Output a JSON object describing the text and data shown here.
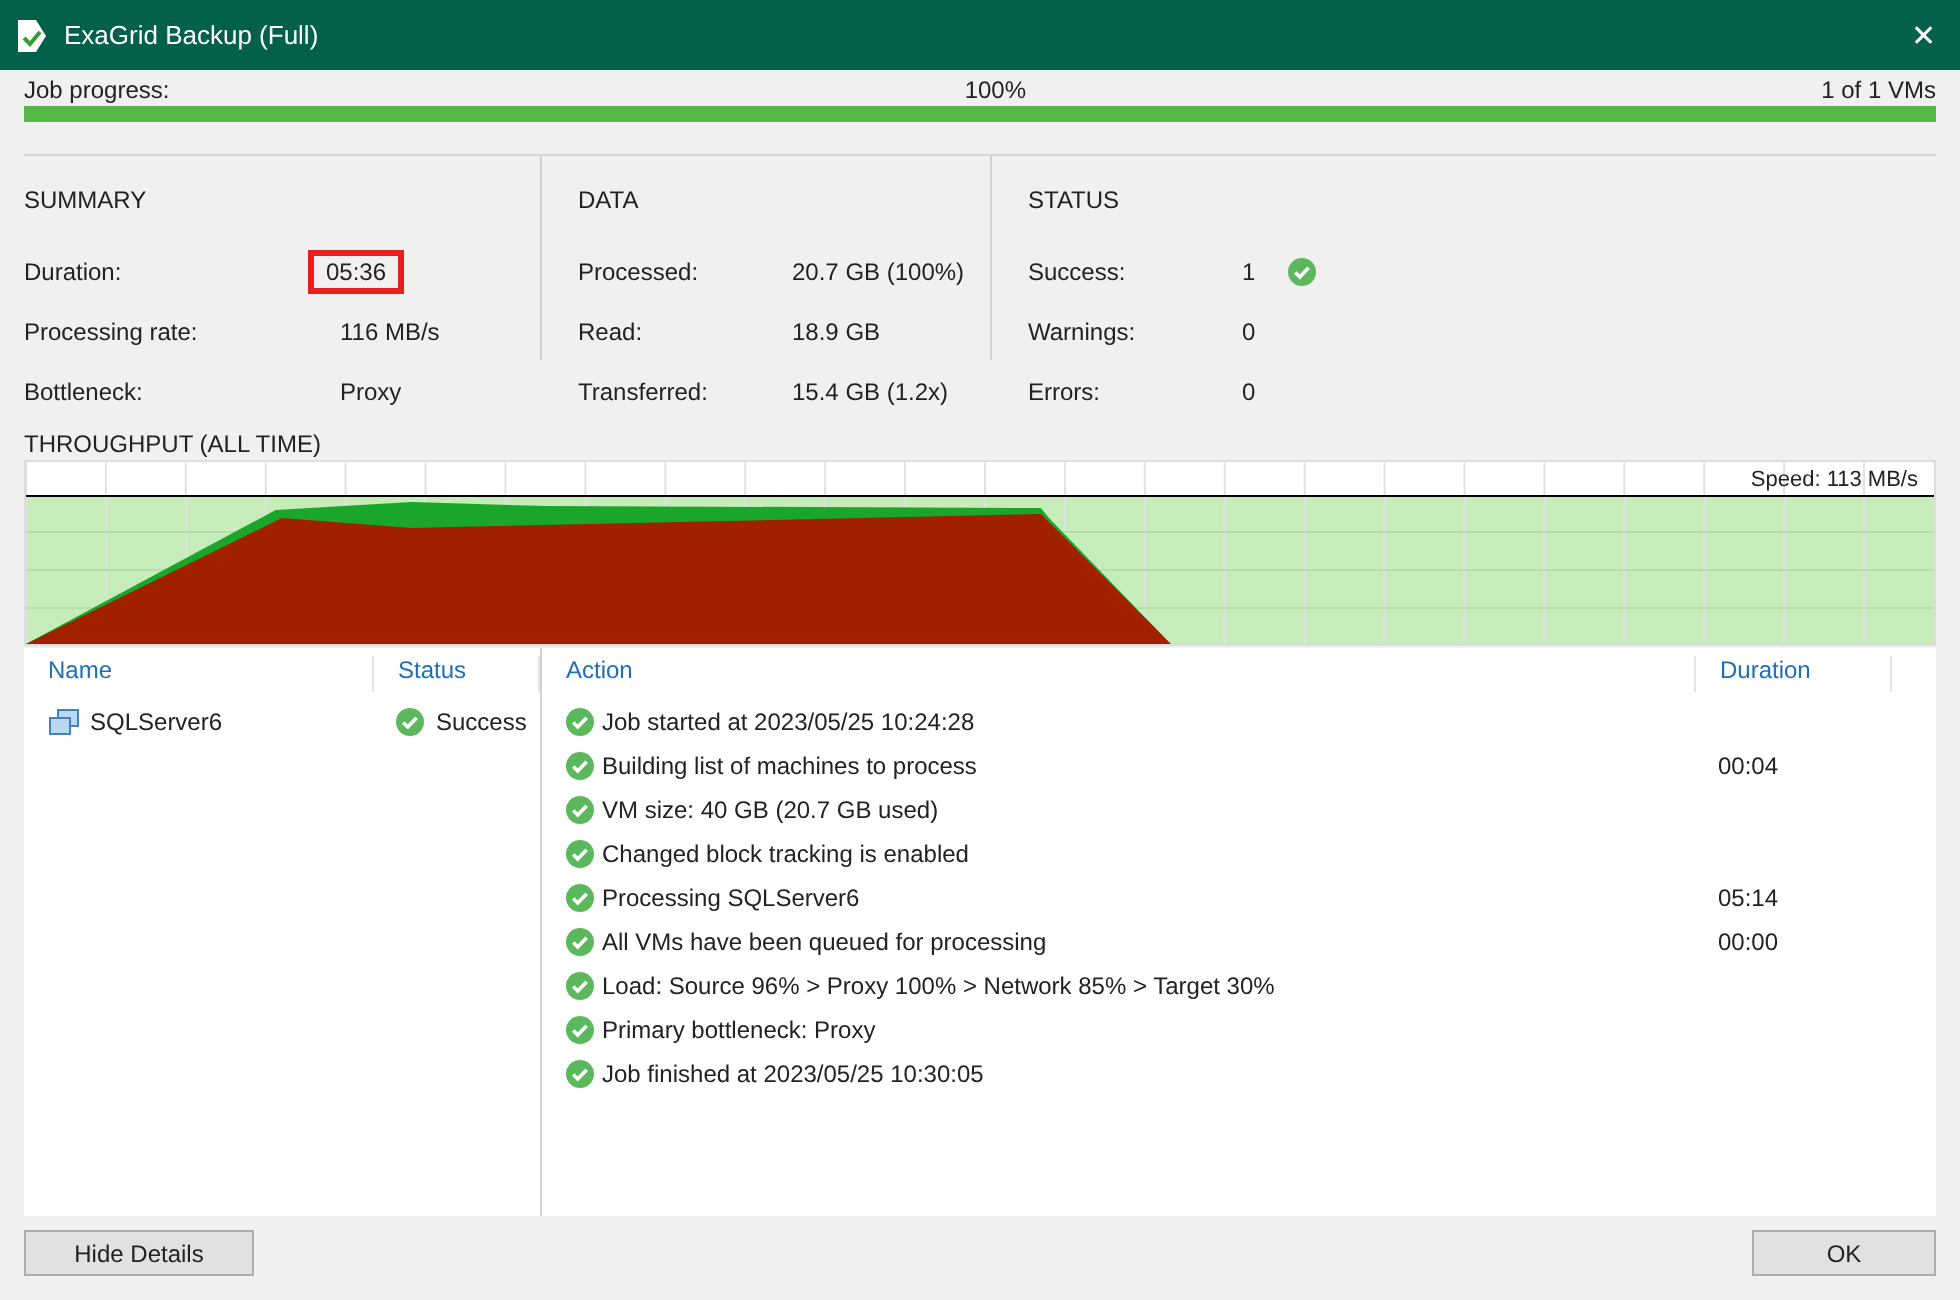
{
  "window": {
    "title": "ExaGrid Backup (Full)",
    "close": "✕"
  },
  "progress": {
    "label": "Job progress:",
    "percent": "100%",
    "count": "1 of 1 VMs",
    "level": 1
  },
  "sections": [
    {
      "title": "SUMMARY",
      "rows": [
        {
          "label": "Duration:",
          "value": "05:36",
          "highlighted": true,
          "ok": false
        },
        {
          "label": "Processing rate:",
          "value": "116 MB/s",
          "highlighted": false,
          "ok": false
        },
        {
          "label": "Bottleneck:",
          "value": "Proxy",
          "highlighted": false,
          "ok": false
        }
      ]
    },
    {
      "title": "DATA",
      "rows": [
        {
          "label": "Processed:",
          "value": "20.7 GB (100%)",
          "highlighted": false,
          "ok": false
        },
        {
          "label": "Read:",
          "value": "18.9 GB",
          "highlighted": false,
          "ok": false
        },
        {
          "label": "Transferred:",
          "value": "15.4 GB (1.2x)",
          "highlighted": false,
          "ok": false
        }
      ]
    },
    {
      "title": "STATUS",
      "rows": [
        {
          "label": "Success:",
          "value": "1",
          "highlighted": false,
          "ok": true
        },
        {
          "label": "Warnings:",
          "value": "0",
          "highlighted": false,
          "ok": false
        },
        {
          "label": "Errors:",
          "value": "0",
          "highlighted": false,
          "ok": false
        }
      ]
    }
  ],
  "throughput": {
    "title": "THROUGHPUT (ALL TIME)",
    "speed": "Speed: 113 MB/s"
  },
  "vm_table": {
    "columns": [
      "Name",
      "Status"
    ],
    "rows": [
      {
        "name": "SQLServer6",
        "status": "Success",
        "selected": false
      }
    ]
  },
  "action_table": {
    "columns": [
      "Action",
      "Duration"
    ],
    "rows": [
      {
        "kind": "success",
        "action": "Job started at 2023/05/25 10:24:28"
      },
      {
        "kind": "success",
        "action": "Building list of machines to process",
        "duration": "00:04"
      },
      {
        "kind": "success",
        "action": "VM size: 40 GB (20.7 GB used)"
      },
      {
        "kind": "success",
        "action": "Changed block tracking is enabled"
      },
      {
        "kind": "success",
        "action": "Processing SQLServer6",
        "duration": "05:14"
      },
      {
        "kind": "success",
        "action": "All VMs have been queued for processing",
        "duration": "00:00"
      },
      {
        "kind": "success",
        "action": "Load: Source 96% > Proxy 100% > Network 85% > Target 30%"
      },
      {
        "kind": "success",
        "action": "Primary bottleneck: Proxy"
      },
      {
        "kind": "success",
        "action": "Job finished at 2023/05/25 10:30:05"
      }
    ]
  },
  "buttons": {
    "left": "Hide Details",
    "right": "OK"
  }
}
